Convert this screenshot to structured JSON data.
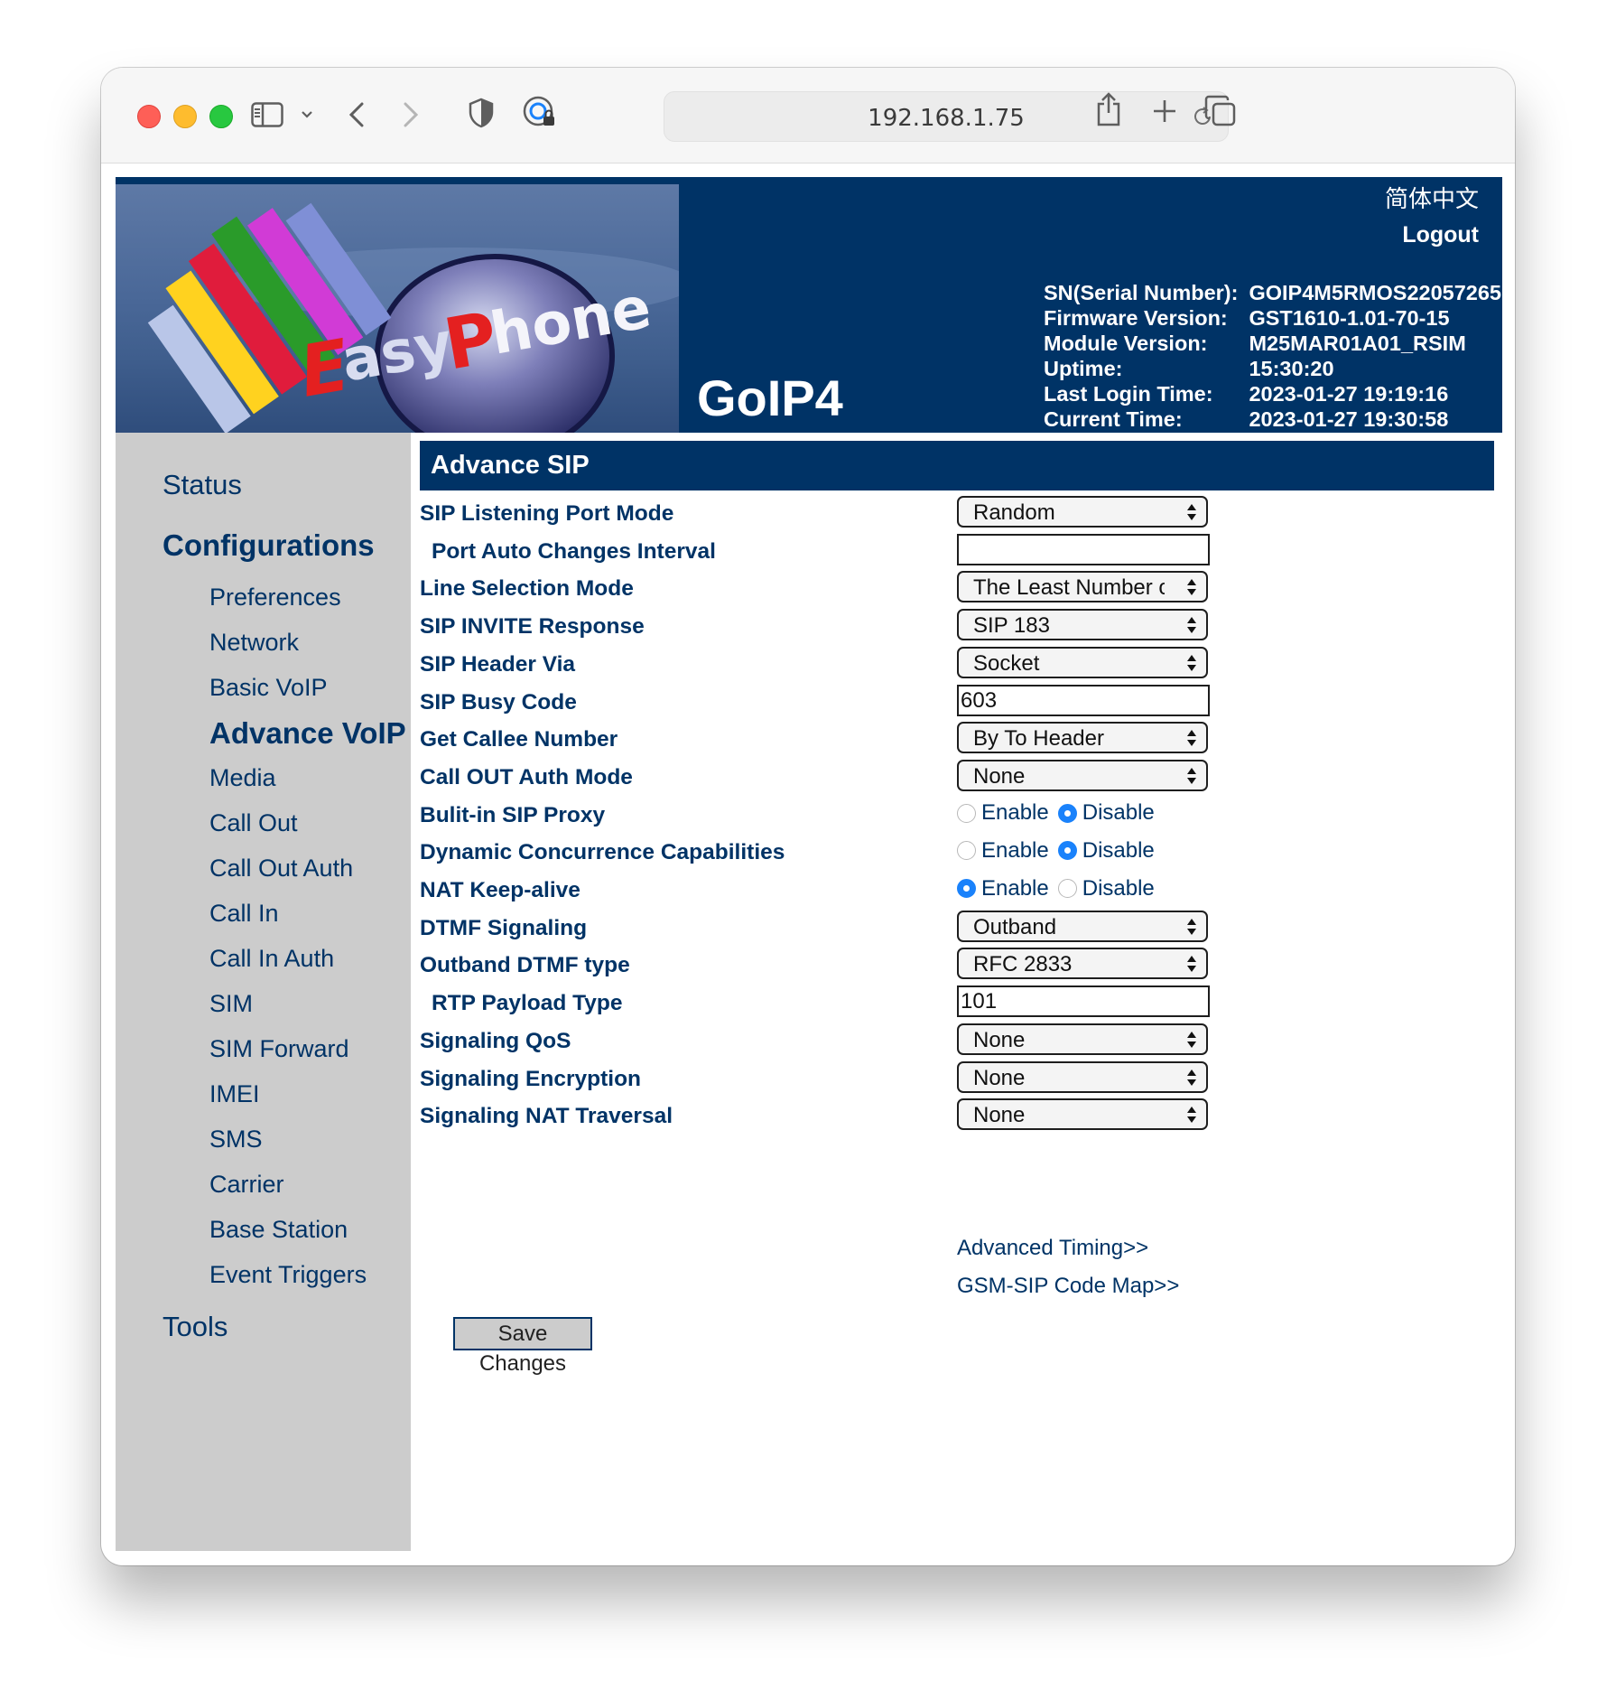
{
  "browser": {
    "url": "192.168.1.75"
  },
  "header": {
    "logo_text": "EasyPhone",
    "model": "GoIP4",
    "language_link": "简体中文",
    "logout": "Logout",
    "info": [
      {
        "key": "SN(Serial Number):",
        "value": "GOIP4M5RMOS22057265"
      },
      {
        "key": "Firmware Version:",
        "value": "GST1610-1.01-70-15"
      },
      {
        "key": "Module Version:",
        "value": "M25MAR01A01_RSIM"
      },
      {
        "key": "Uptime:",
        "value": "15:30:20"
      },
      {
        "key": "Last Login Time:",
        "value": "2023-01-27 19:19:16"
      },
      {
        "key": "Current Time:",
        "value": "2023-01-27 19:30:58"
      }
    ]
  },
  "sidebar": {
    "status": "Status",
    "configurations": "Configurations",
    "items": [
      "Preferences",
      "Network",
      "Basic VoIP",
      "Advance VoIP",
      "Media",
      "Call Out",
      "Call Out Auth",
      "Call In",
      "Call In Auth",
      "SIM",
      "SIM Forward",
      "IMEI",
      "SMS",
      "Carrier",
      "Base Station",
      "Event Triggers"
    ],
    "active_item": "Advance VoIP",
    "tools": "Tools"
  },
  "section": {
    "title": "Advance SIP"
  },
  "form": {
    "rows": [
      {
        "label": "SIP Listening Port Mode",
        "type": "select",
        "value": "Random"
      },
      {
        "label": "Port Auto Changes Interval",
        "type": "text",
        "value": ""
      },
      {
        "label": "Line Selection Mode",
        "type": "select",
        "value": "The Least Number o"
      },
      {
        "label": "SIP INVITE Response",
        "type": "select",
        "value": "SIP 183"
      },
      {
        "label": "SIP Header Via",
        "type": "select",
        "value": "Socket"
      },
      {
        "label": "SIP Busy Code",
        "type": "text",
        "value": "603"
      },
      {
        "label": "Get Callee Number",
        "type": "select",
        "value": "By To Header"
      },
      {
        "label": "Call OUT Auth Mode",
        "type": "select",
        "value": "None"
      },
      {
        "label": "Bulit-in SIP Proxy",
        "type": "radio",
        "options": [
          "Enable",
          "Disable"
        ],
        "selected": "Disable"
      },
      {
        "label": "Dynamic Concurrence Capabilities",
        "type": "radio",
        "options": [
          "Enable",
          "Disable"
        ],
        "selected": "Disable"
      },
      {
        "label": "NAT Keep-alive",
        "type": "radio",
        "options": [
          "Enable",
          "Disable"
        ],
        "selected": "Enable"
      },
      {
        "label": "DTMF Signaling",
        "type": "select",
        "value": "Outband"
      },
      {
        "label": "Outband DTMF type",
        "type": "select",
        "value": "RFC 2833"
      },
      {
        "label": "RTP Payload Type",
        "type": "text",
        "value": "101"
      },
      {
        "label": "Signaling QoS",
        "type": "select",
        "value": "None"
      },
      {
        "label": "Signaling Encryption",
        "type": "select",
        "value": "None"
      },
      {
        "label": "Signaling NAT Traversal",
        "type": "select",
        "value": "None"
      }
    ],
    "links": {
      "advanced_timing": "Advanced Timing>>",
      "code_map": "GSM-SIP Code Map>>"
    },
    "save_label": "Save Changes"
  },
  "colors": {
    "navy": "#003366",
    "sidebar_bg": "#cccccc",
    "radio_selected": "#1a82fb"
  }
}
